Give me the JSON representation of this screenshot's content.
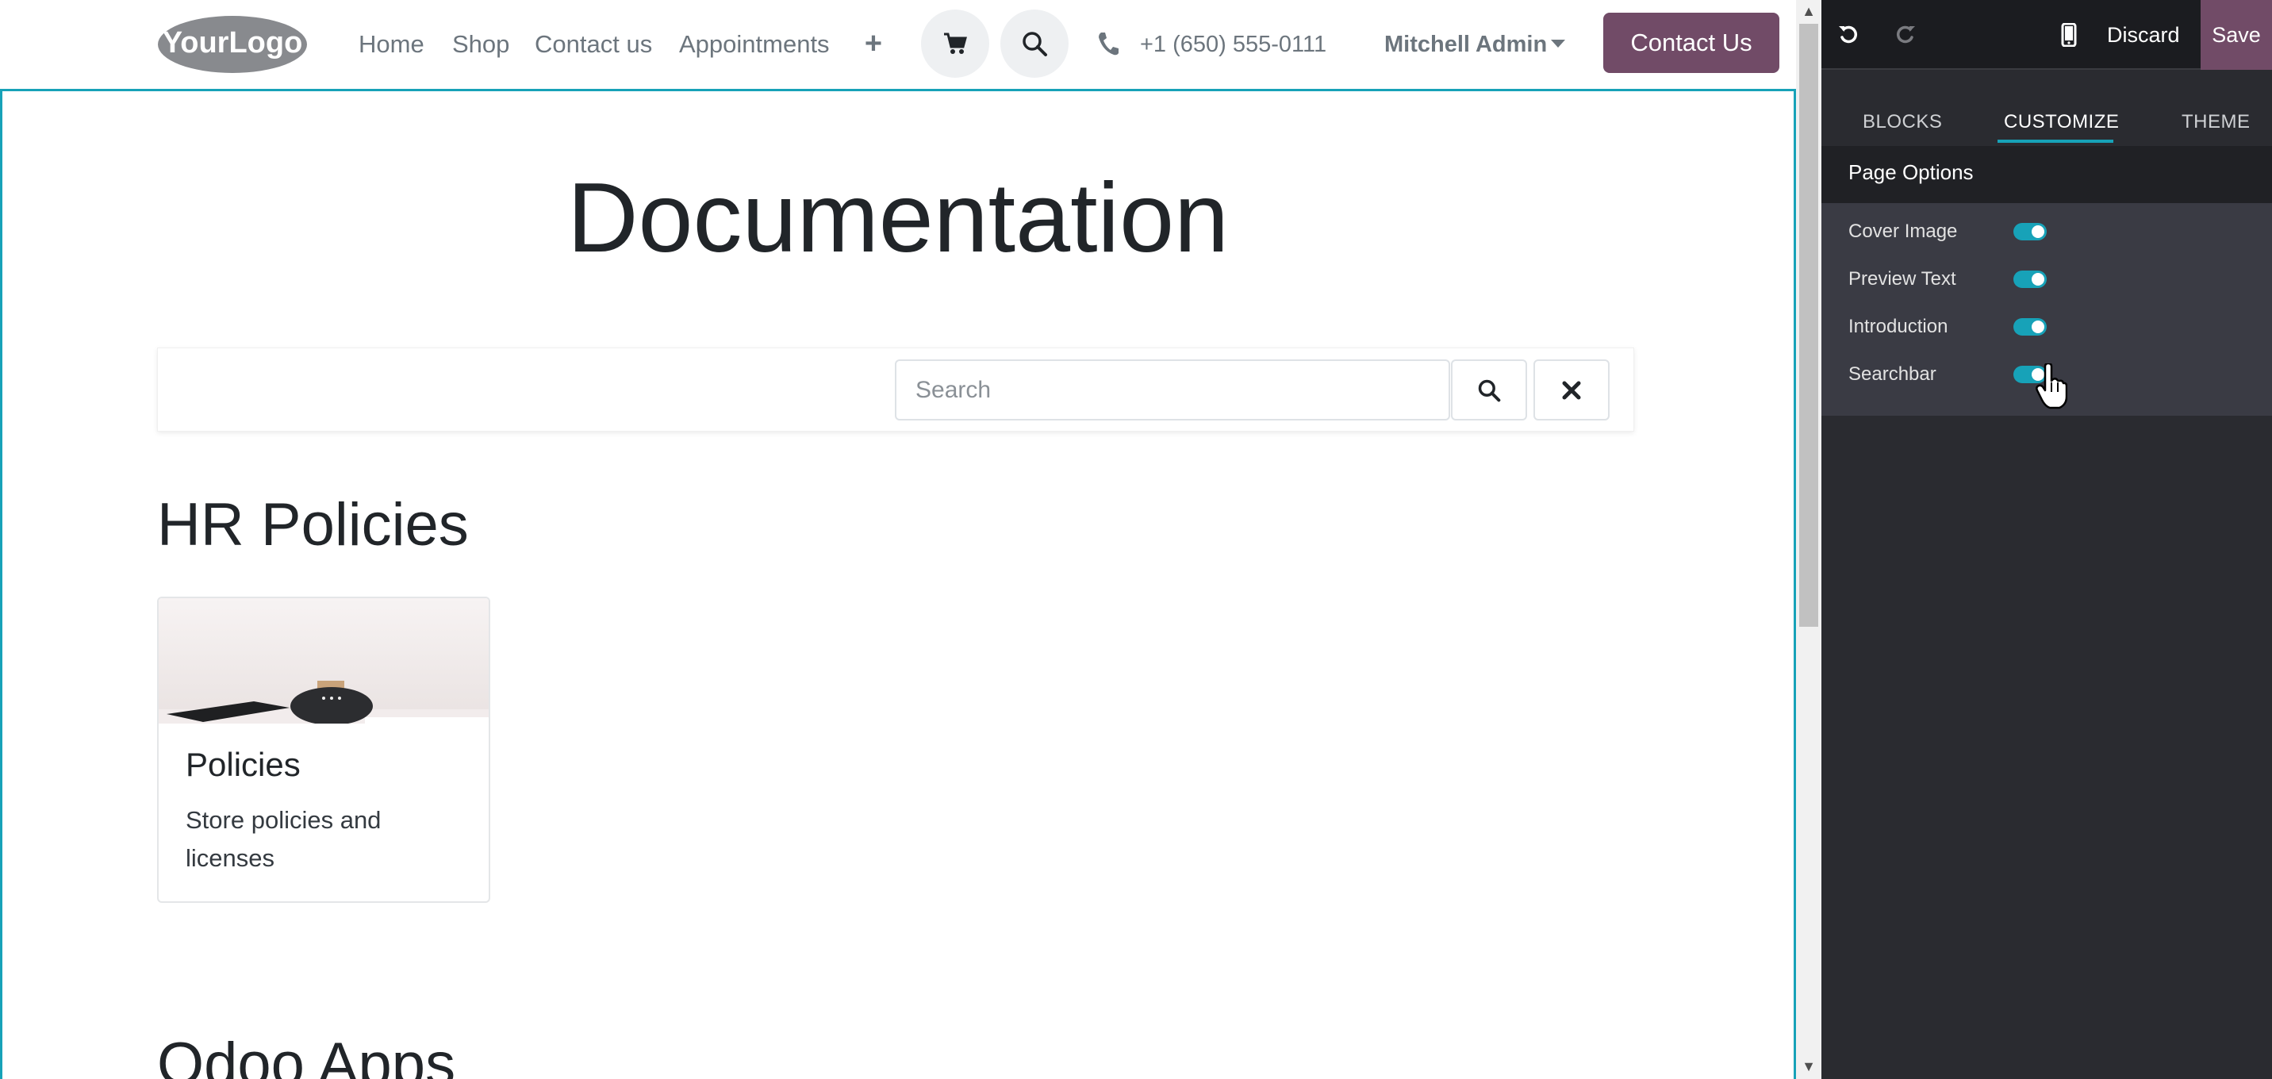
{
  "navbar": {
    "logo_text": "YourLogo",
    "links": [
      "Home",
      "Shop",
      "Contact us",
      "Appointments"
    ],
    "phone": "+1 (650) 555-0111",
    "user": "Mitchell Admin",
    "cta_label": "Contact Us"
  },
  "page": {
    "title": "Documentation",
    "search_placeholder": "Search",
    "sections": [
      {
        "title": "HR Policies",
        "cards": [
          {
            "title": "Policies",
            "text": "Store policies and licenses"
          }
        ]
      },
      {
        "title": "Odoo Apps"
      }
    ]
  },
  "editor": {
    "discard_label": "Discard",
    "save_label": "Save",
    "tabs": [
      "BLOCKS",
      "CUSTOMIZE",
      "THEME"
    ],
    "active_tab": "CUSTOMIZE",
    "section_title": "Page Options",
    "options": [
      {
        "label": "Cover Image",
        "enabled": true
      },
      {
        "label": "Preview Text",
        "enabled": true
      },
      {
        "label": "Introduction",
        "enabled": true
      },
      {
        "label": "Searchbar",
        "enabled": true
      }
    ]
  },
  "colors": {
    "brand": "#714b67",
    "accent": "#17a2b8",
    "panel_bg": "#2a2b30"
  }
}
